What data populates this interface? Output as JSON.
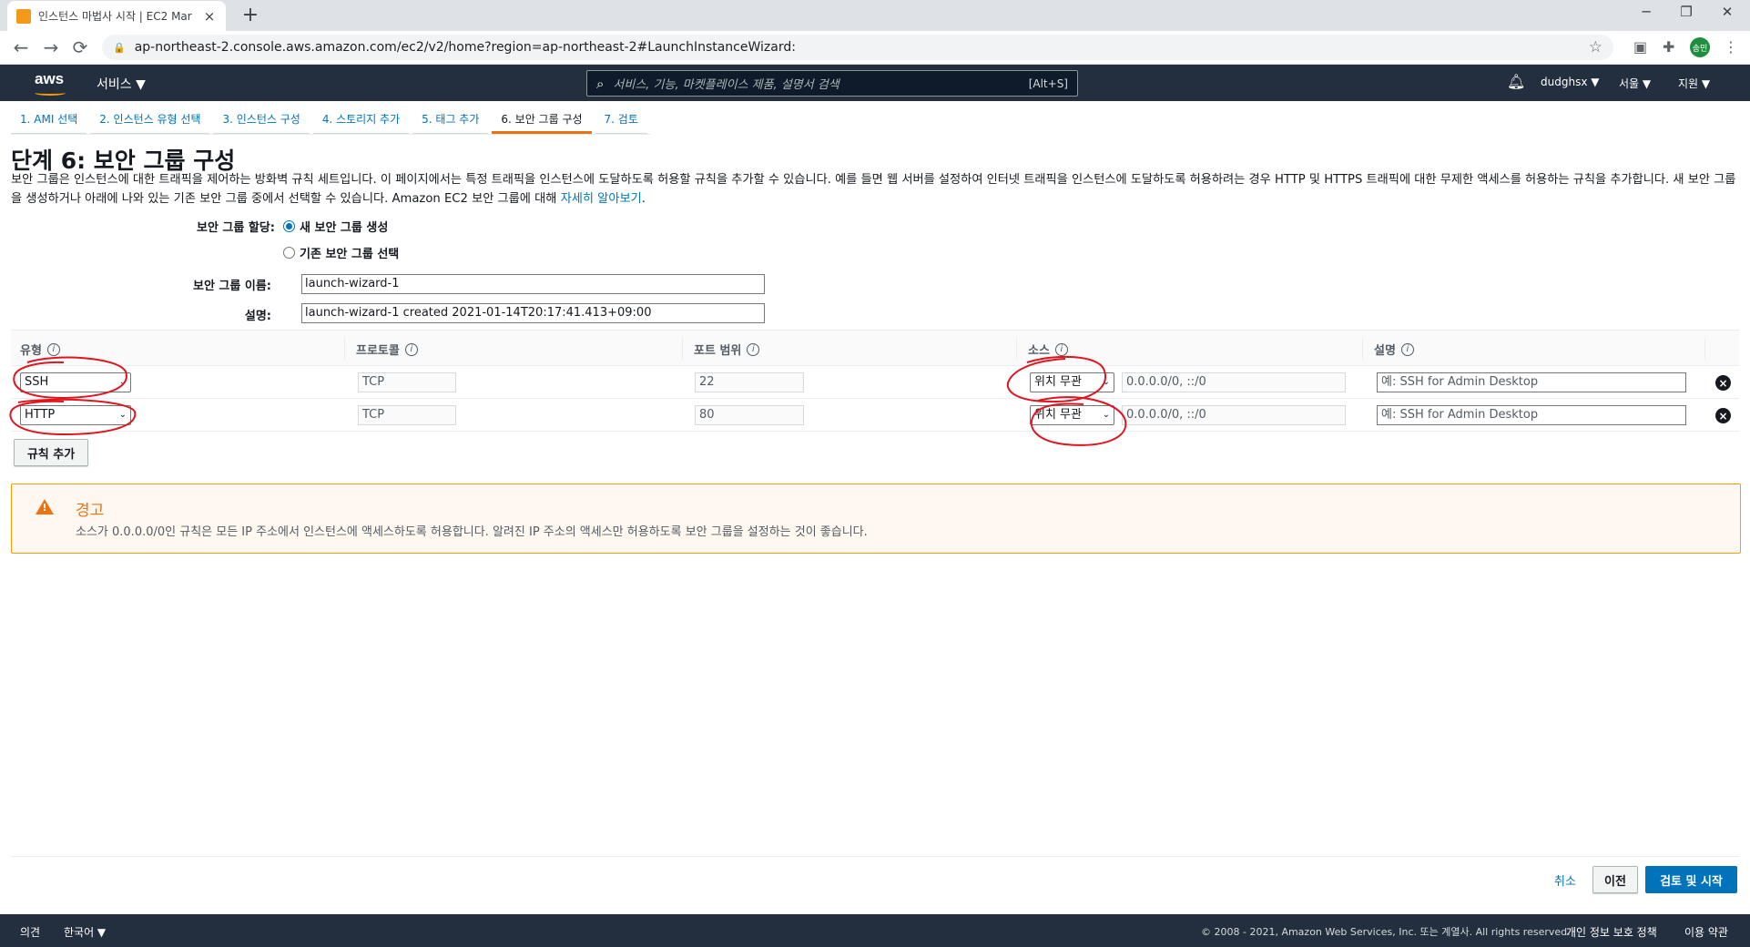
{
  "browser": {
    "tab_title": "인스턴스 마법사 시작 | EC2 Mar",
    "tab_close": "×",
    "new_tab": "+",
    "url": "ap-northeast-2.console.aws.amazon.com/ec2/v2/home?region=ap-northeast-2#LaunchInstanceWizard:",
    "profile_initial": "송민",
    "window_controls": [
      "─",
      "❐",
      "✕"
    ],
    "nav_buttons": [
      "←",
      "→",
      "⟳"
    ]
  },
  "aws_nav": {
    "logo": "aws",
    "services": "서비스 ▼",
    "search_placeholder": "서비스, 기능, 마켓플레이스 제품, 설명서 검색",
    "search_shortcut": "[Alt+S]",
    "user": "dudghsx ▼",
    "region": "서울 ▼",
    "support": "지원 ▼"
  },
  "wizard_steps": [
    {
      "label": "1. AMI 선택"
    },
    {
      "label": "2. 인스턴스 유형 선택"
    },
    {
      "label": "3. 인스턴스 구성"
    },
    {
      "label": "4. 스토리지 추가"
    },
    {
      "label": "5. 태그 추가"
    },
    {
      "label": "6. 보안 그룹 구성"
    },
    {
      "label": "7. 검토"
    }
  ],
  "active_step": 5,
  "page": {
    "title": "단계 6: 보안 그룹 구성",
    "description": "보안 그룹은 인스턴스에 대한 트래픽을 제어하는 방화벽 규칙 세트입니다. 이 페이지에서는 특정 트래픽을 인스턴스에 도달하도록 허용할 규칙을 추가할 수 있습니다. 예를 들면 웹 서버를 설정하여 인터넷 트래픽을 인스턴스에 도달하도록 허용하려는 경우 HTTP 및 HTTPS 트래픽에 대한 무제한 액세스를 허용하는 규칙을 추가합니다. 새 보안 그룹을 생성하거나 아래에 나와 있는 기존 보안 그룹 중에서 선택할 수 있습니다. Amazon EC2 보안 그룹에 대해 ",
    "learn_more": "자세히 알아보기",
    "learn_more_suffix": "."
  },
  "form": {
    "assign_label": "보안 그룹 할당:",
    "option_new": "새 보안 그룹 생성",
    "option_existing": "기존 보안 그룹 선택",
    "option_new_selected": true,
    "name_label": "보안 그룹 이름:",
    "name_value": "launch-wizard-1",
    "desc_label": "설명:",
    "desc_value": "launch-wizard-1 created 2021-01-14T20:17:41.413+09:00"
  },
  "table": {
    "headers": [
      "유형",
      "프로토콜",
      "포트 범위",
      "소스",
      "설명"
    ],
    "info_glyph": "i",
    "rows": [
      {
        "type": "SSH",
        "protocol": "TCP",
        "port": "22",
        "source": "위치 무관",
        "cidr": "0.0.0.0/0, ::/0",
        "desc_placeholder": "예: SSH for Admin Desktop"
      },
      {
        "type": "HTTP",
        "protocol": "TCP",
        "port": "80",
        "source": "위치 무관",
        "cidr": "0.0.0.0/0, ::/0",
        "desc_placeholder": "예: SSH for Admin Desktop"
      }
    ],
    "add_rule": "규칙 추가",
    "delete_glyph": "×",
    "chevron": "⌄"
  },
  "warning": {
    "title": "경고",
    "text": "소스가 0.0.0.0/0인 규칙은 모든 IP 주소에서 인스턴스에 액세스하도록 허용합니다. 알려진 IP 주소의 액세스만 허용하도록 보안 그룹을 설정하는 것이 좋습니다.",
    "bang": "!"
  },
  "actions": {
    "cancel": "취소",
    "previous": "이전",
    "review_launch": "검토 및 시작"
  },
  "footer": {
    "feedback": "의견",
    "language": "한국어 ▼",
    "copyright": "© 2008 - 2021, Amazon Web Services, Inc. 또는 계열사. All rights reserved.",
    "privacy": "개인 정보 보호 정책",
    "terms": "이용 약관"
  },
  "colors": {
    "aws_nav": "#232f3e",
    "accent_orange": "#ec7211",
    "link_blue": "#0073bb",
    "annotation_red": "#e0141e"
  }
}
